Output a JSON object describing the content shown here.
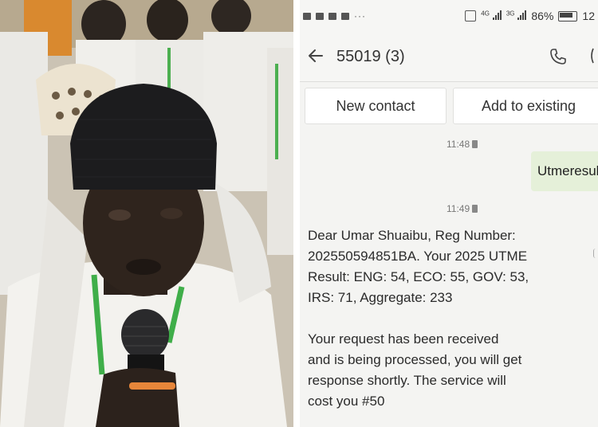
{
  "status_bar": {
    "battery": "86%",
    "time_partial": "12",
    "network_a": "4G",
    "network_b": "3G"
  },
  "header": {
    "title": "55019 (3)"
  },
  "contact_actions": {
    "new_contact": "New contact",
    "add_to_existing": "Add to existing"
  },
  "messages": {
    "timestamp_1": "11:48",
    "sent_text": "Utmeresult",
    "timestamp_2": "11:49",
    "received_1": "Dear Umar Shuaibu, Reg Number:\n202550594851BA. Your 2025 UTME\nResult: ENG: 54, ECO: 55, GOV: 53,\nIRS: 71, Aggregate: 233",
    "received_2": "Your request has been received\nand is being processed, you will get\nresponse shortly. The service will\ncost you #50"
  },
  "colors": {
    "sent_bubble": "#e5f0d9",
    "background": "#f4f4f2"
  }
}
